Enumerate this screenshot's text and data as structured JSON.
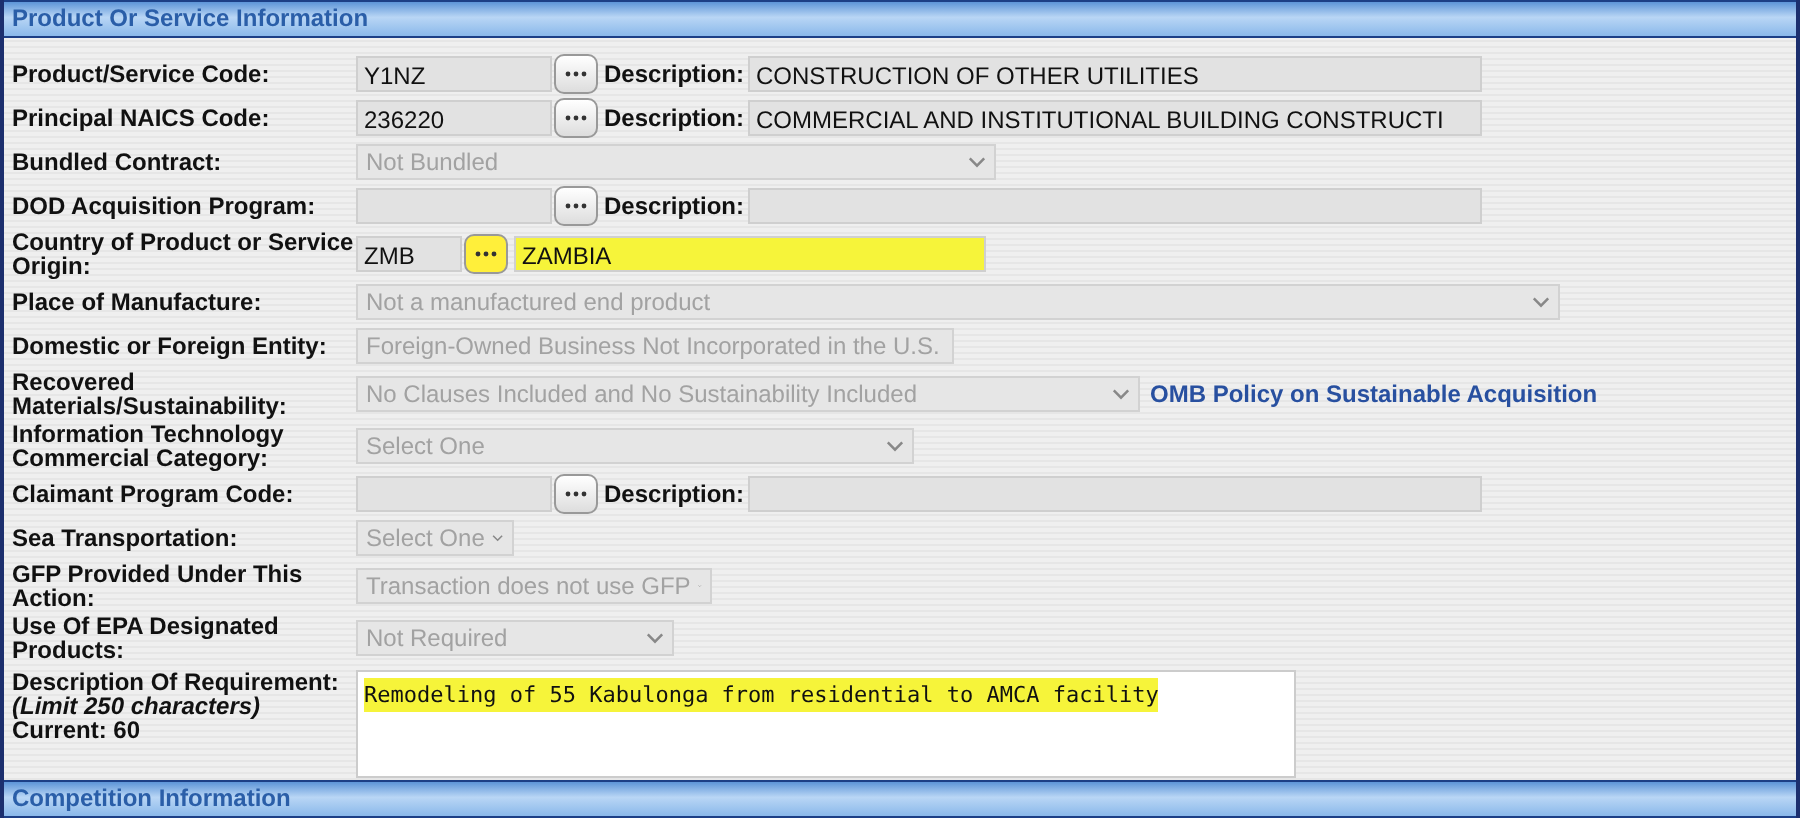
{
  "section": {
    "title": "Product Or Service Information"
  },
  "rows": [
    {
      "kind": "lookup",
      "label": "Product/Service Code:",
      "code": "Y1NZ",
      "description_label": "Description:",
      "description": "CONSTRUCTION OF OTHER UTILITIES",
      "highlighted": false
    },
    {
      "kind": "lookup",
      "label": "Principal NAICS Code:",
      "code": "236220",
      "description_label": "Description:",
      "description": "COMMERCIAL AND INSTITUTIONAL BUILDING CONSTRUCTI",
      "highlighted": false
    },
    {
      "kind": "select",
      "label": "Bundled Contract:",
      "value": "Not Bundled",
      "disabled": true
    },
    {
      "kind": "lookup",
      "label": "DOD Acquisition Program:",
      "description_label": "Description:",
      "highlighted": false
    },
    {
      "kind": "lookup",
      "label": "Country of Product or Service Origin:",
      "code": "ZMB",
      "description": "ZAMBIA",
      "highlighted": true
    },
    {
      "kind": "select",
      "label": "Place of Manufacture:",
      "value": "Not a manufactured end product",
      "disabled": true
    },
    {
      "kind": "select",
      "label": "Domestic or Foreign Entity:",
      "value": "Foreign-Owned Business Not Incorporated in the U.S.",
      "disabled": true
    },
    {
      "kind": "select",
      "label": "Recovered Materials/Sustainability:",
      "value": "No Clauses Included and No Sustainability Included",
      "disabled": true,
      "link": "OMB Policy on Sustainable Acquisition"
    },
    {
      "kind": "select",
      "label": "Information Technology Commercial Category:",
      "value": "Select One",
      "disabled": true
    },
    {
      "kind": "lookup",
      "label": "Claimant Program Code:",
      "description_label": "Description:",
      "highlighted": false
    },
    {
      "kind": "select",
      "label": "Sea Transportation:",
      "value": "Select One",
      "disabled": true
    },
    {
      "kind": "select",
      "label": "GFP Provided Under This Action:",
      "value": "Transaction does not use GFP",
      "disabled": true
    },
    {
      "kind": "select",
      "label": "Use Of EPA Designated Products:",
      "value": "Not Required",
      "disabled": true
    },
    {
      "kind": "textarea",
      "label": "Description Of Requirement:",
      "note": "(Limit 250 characters)",
      "count": "Current: 60",
      "value": "Remodeling of 55 Kabulonga from residential to AMCA facility",
      "highlighted": true
    }
  ],
  "next_section": {
    "title": "Competition Information"
  }
}
